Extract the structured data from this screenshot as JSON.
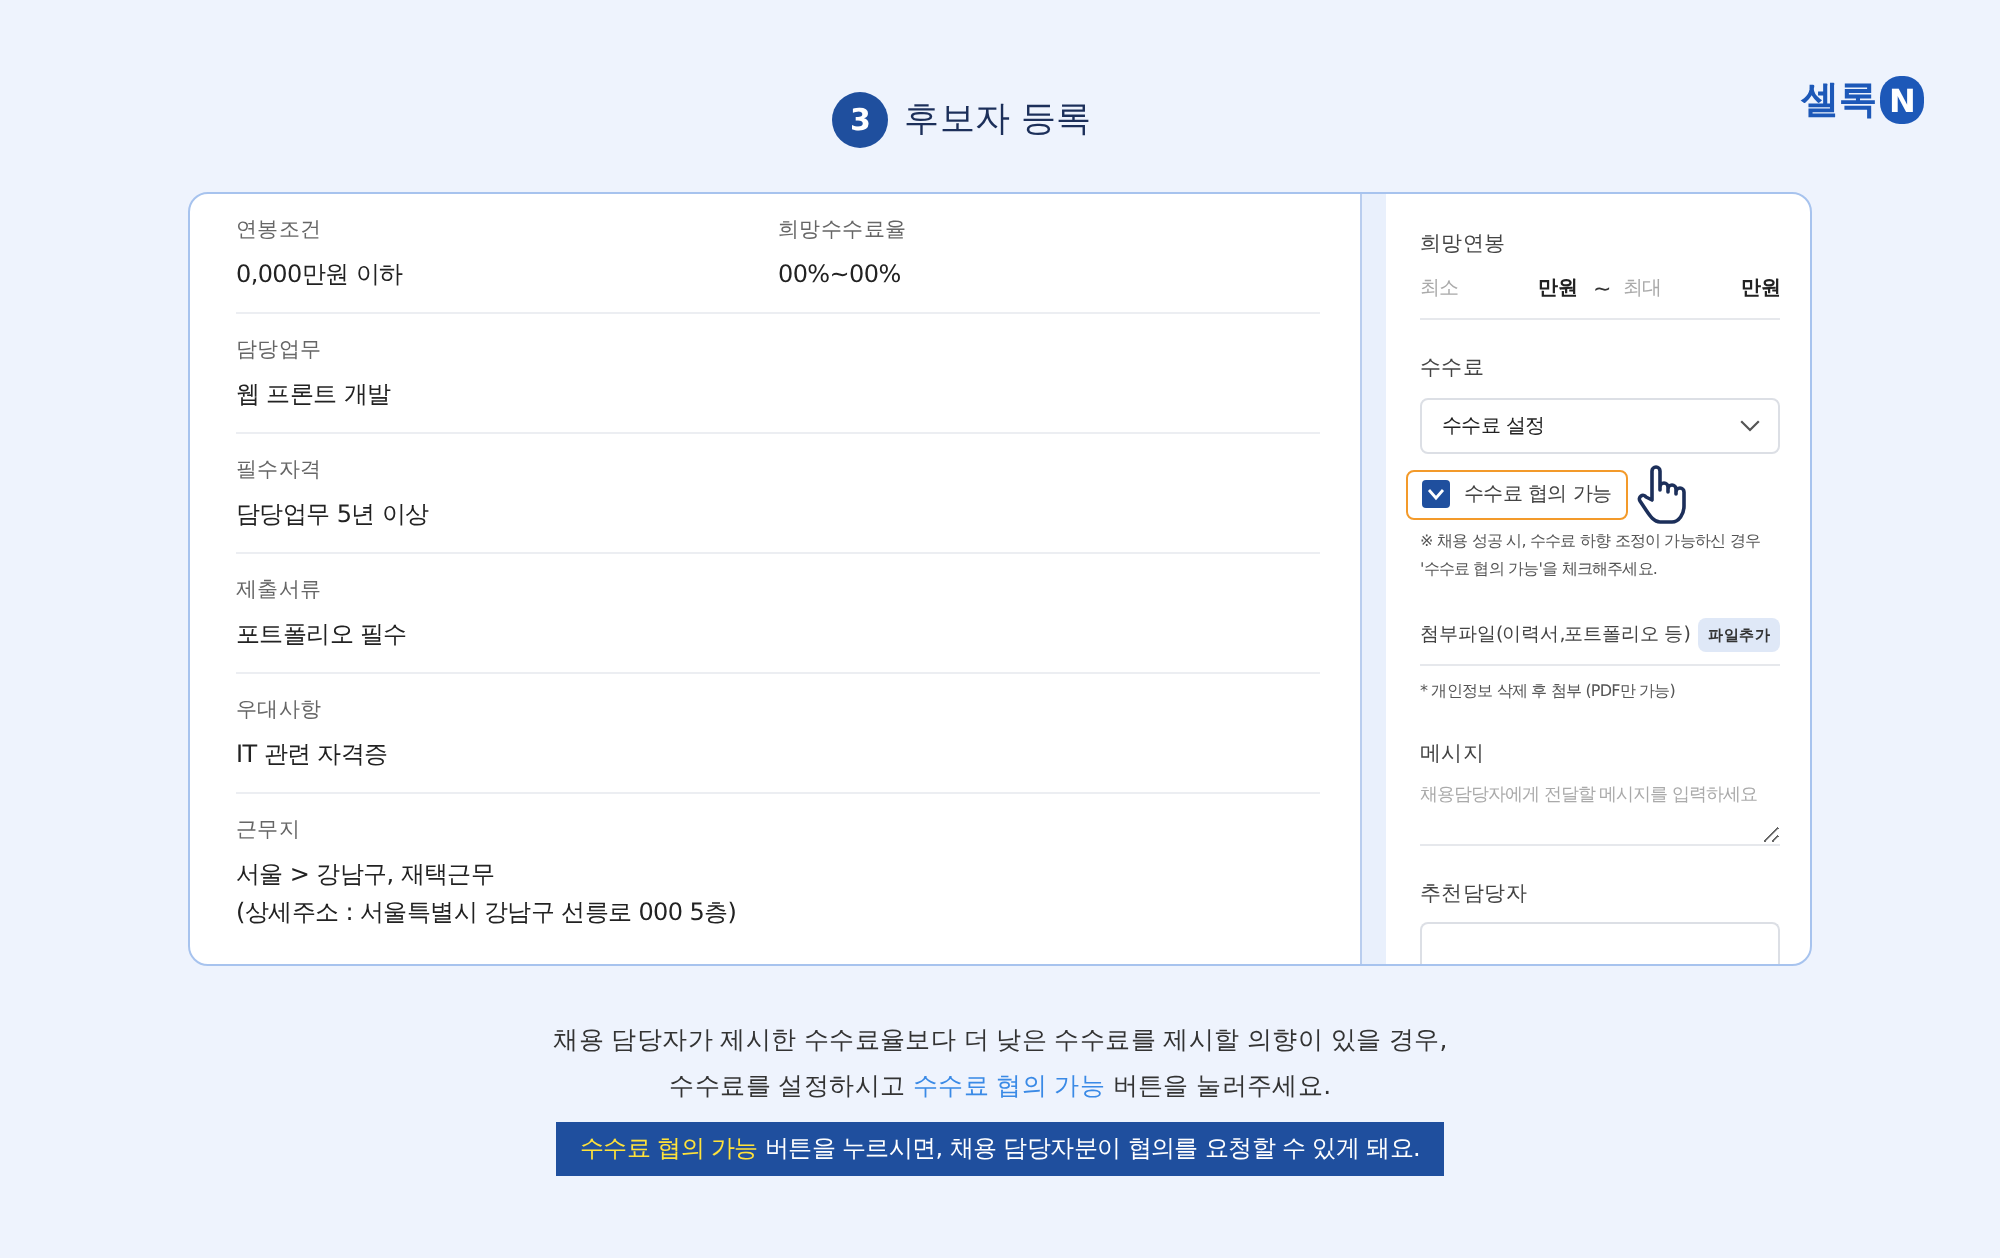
{
  "header": {
    "step": "3",
    "title": "후보자 등록"
  },
  "logo": {
    "text": "셀록",
    "badge": "N"
  },
  "job_details": {
    "rows": [
      {
        "items": [
          {
            "label": "연봉조건",
            "lines": [
              "0,000만원 이하"
            ]
          },
          {
            "label": "희망수수료율",
            "lines": [
              "00%~00%"
            ]
          }
        ]
      },
      {
        "items": [
          {
            "label": "담당업무",
            "lines": [
              "웹 프론트 개발"
            ]
          }
        ]
      },
      {
        "items": [
          {
            "label": "필수자격",
            "lines": [
              "담당업무 5년 이상"
            ]
          }
        ]
      },
      {
        "items": [
          {
            "label": "제출서류",
            "lines": [
              "포트폴리오 필수"
            ]
          }
        ]
      },
      {
        "items": [
          {
            "label": "우대사항",
            "lines": [
              "IT 관련 자격증"
            ]
          }
        ]
      },
      {
        "items": [
          {
            "label": "근무지",
            "lines": [
              "서울 > 강남구, 재택근무",
              "(상세주소 : 서울특별시 강남구 선릉로 000 5층)"
            ]
          }
        ]
      }
    ]
  },
  "application_form": {
    "desired_salary": {
      "label": "희망연봉",
      "min": {
        "placeholder": "최소",
        "unit": "만원"
      },
      "separator": "~",
      "max": {
        "placeholder": "최대",
        "unit": "만원"
      }
    },
    "fee": {
      "label": "수수료",
      "select": {
        "value": "수수료 설정"
      },
      "negotiable": {
        "label": "수수료 협의 가능",
        "checked": true,
        "highlighted": true
      },
      "note_lines": [
        "※ 채용 성공 시, 수수료 하향 조정이 가능하신 경우",
        "'수수료 협의 가능'을 체크해주세요."
      ]
    },
    "attachment": {
      "label": "첨부파일(이력서,포트폴리오 등)",
      "button": "파일추가",
      "note": "* 개인정보 삭제 후 첨부 (PDF만 가능)"
    },
    "message": {
      "label": "메시지",
      "placeholder": "채용담당자에게 전달할 메시지를 입력하세요"
    },
    "recommender": {
      "label": "추천담당자"
    }
  },
  "instructions": {
    "lines": [
      [
        {
          "text": "채용 담당자가 제시한 수수료율보다 더 낮은 수수료를 제시할 의향이 있을 경우,",
          "highlight": false
        }
      ],
      [
        {
          "text": "수수료를 설정하시고 ",
          "highlight": false
        },
        {
          "text": "수수료 협의 가능",
          "highlight": true
        },
        {
          "text": " 버튼을 눌러주세요.",
          "highlight": false
        }
      ]
    ],
    "banner": [
      {
        "text": "수수료 협의 가능",
        "highlight": true
      },
      {
        "text": " 버튼을 누르시면, 채용 담당자분이 협의를 요청할 수 있게 돼요.",
        "highlight": false
      }
    ]
  }
}
